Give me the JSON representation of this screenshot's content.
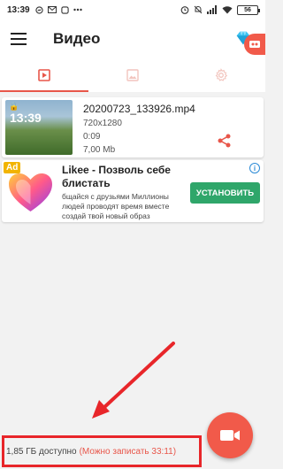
{
  "status_bar": {
    "time": "13:39",
    "battery": "56"
  },
  "app_bar": {
    "title": "Видео"
  },
  "tabs": [
    {
      "icon": "video-icon",
      "active": true
    },
    {
      "icon": "image-icon",
      "active": false
    },
    {
      "icon": "settings-icon",
      "active": false
    }
  ],
  "video": {
    "filename": "20200723_133926.mp4",
    "resolution": "720x1280",
    "duration": "0:09",
    "size": "7,00 Mb",
    "thumb_time": "13:39"
  },
  "ad": {
    "badge": "Ad",
    "title": "Likee - Позволь себе блистать",
    "description": "бщайся с друзьями Миллионы людей проводят время вместе создай твой новый образ",
    "install_label": "УСТАНОВИТЬ"
  },
  "footer": {
    "storage": "1,85 ГБ доступно",
    "record_time": "(Можно записать 33:11)"
  },
  "colors": {
    "accent": "#f15a4a",
    "install": "#2fa66a",
    "annotation": "#e8262a"
  }
}
